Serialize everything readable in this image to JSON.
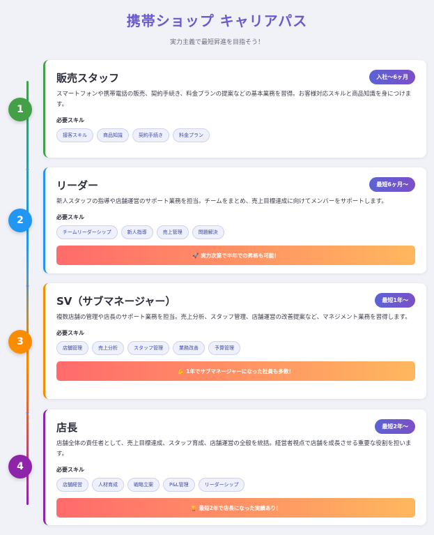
{
  "header": {
    "title": "携帯ショップ キャリアパス",
    "subtitle": "実力主義で最短昇進を目指そう！"
  },
  "steps": [
    {
      "number": "1",
      "title": "販売スタッフ",
      "badge": "入社〜6ヶ月",
      "description": "スマートフォンや携帯電話の販売、契約手続き、料金プランの提案などの基本業務を習得。お客様対応スキルと商品知識を身につけます。",
      "skills_label": "必要スキル",
      "skills": [
        "接客スキル",
        "商品知識",
        "契約手続き",
        "料金プラン"
      ],
      "highlight": "",
      "color": "#43a047"
    },
    {
      "number": "2",
      "title": "リーダー",
      "badge": "最短6ヶ月〜",
      "description": "新人スタッフの指導や店舗運営のサポート業務を担当。チームをまとめ、売上目標達成に向けてメンバーをサポートします。",
      "skills_label": "必要スキル",
      "skills": [
        "チームリーダーシップ",
        "新人指導",
        "売上管理",
        "問題解決"
      ],
      "highlight": "🚀 実力次第で半年での昇格も可能！",
      "color": "#2196f3"
    },
    {
      "number": "3",
      "title": "SV（サブマネージャー）",
      "badge": "最短1年〜",
      "description": "複数店舗の管理や店長のサポート業務を担当。売上分析、スタッフ管理、店舗運営の改善提案など、マネジメント業務を習得します。",
      "skills_label": "必要スキル",
      "skills": [
        "店舗管理",
        "売上分析",
        "スタッフ管理",
        "業務改善",
        "予算管理"
      ],
      "highlight": "💪 1年でサブマネージャーになった社員も多数！",
      "color": "#fb8c00"
    },
    {
      "number": "4",
      "title": "店長",
      "badge": "最短2年〜",
      "description": "店舗全体の責任者として、売上目標達成、スタッフ育成、店舗運営の全般を統括。経営者視点で店舗を成長させる重要な役割を担います。",
      "skills_label": "必要スキル",
      "skills": [
        "店舗経営",
        "人材育成",
        "戦略立案",
        "P&L管理",
        "リーダーシップ"
      ],
      "highlight": "🏆 最短2年で店長になった実績あり！",
      "color": "#8e24aa"
    }
  ]
}
